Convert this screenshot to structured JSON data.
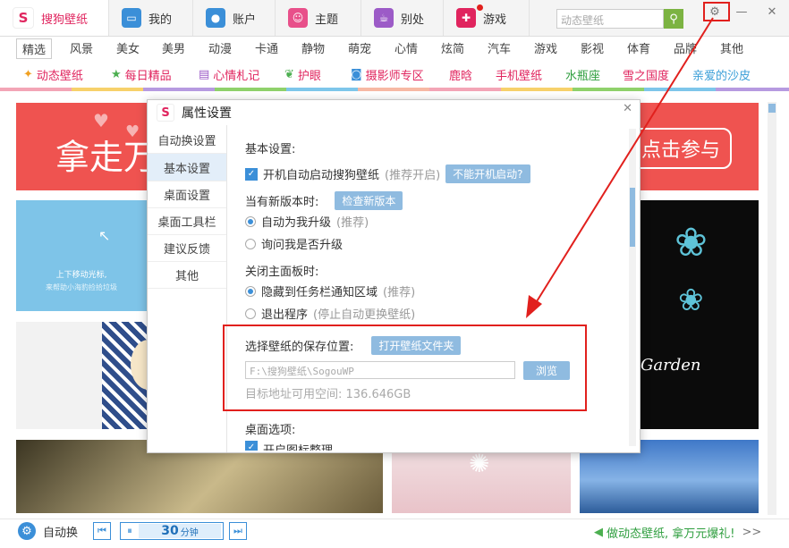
{
  "tabs": [
    {
      "label": "搜狗壁纸",
      "icon": "sogou-logo-icon"
    },
    {
      "label": "我的",
      "icon": "monitor-icon"
    },
    {
      "label": "账户",
      "icon": "user-icon"
    },
    {
      "label": "主题",
      "icon": "theme-icon"
    },
    {
      "label": "别处",
      "icon": "cup-icon"
    },
    {
      "label": "游戏",
      "icon": "gamepad-icon"
    }
  ],
  "search": {
    "placeholder": "动态壁纸"
  },
  "categories": [
    "精选",
    "风景",
    "美女",
    "美男",
    "动漫",
    "卡通",
    "静物",
    "萌宠",
    "心情",
    "炫简",
    "汽车",
    "游戏",
    "影视",
    "体育",
    "品牌",
    "其他"
  ],
  "subcats": [
    "动态壁纸",
    "每日精品",
    "心情札记",
    "护眼",
    "摄影师专区",
    "鹿晗",
    "手机壁纸",
    "水瓶座",
    "雪之国度",
    "亲爱的沙皮"
  ],
  "banner": {
    "left_text": "拿走万",
    "right_text": "点击参与"
  },
  "tile_text": {
    "line1": "上下移动光标,",
    "line2": "来帮助小海豹捡拾垃圾",
    "garden": "Garden"
  },
  "dialog": {
    "title": "属性设置",
    "nav": [
      "自动换设置",
      "基本设置",
      "桌面设置",
      "桌面工具栏",
      "建议反馈",
      "其他"
    ],
    "basic_heading": "基本设置:",
    "autostart": "开机自动启动搜狗壁纸",
    "autostart_hint": "(推荐开启)",
    "autostart_btn": "不能开机启动?",
    "update_heading": "当有新版本时:",
    "update_btn": "检查新版本",
    "update_opt1": "自动为我升级",
    "update_opt1_hint": "(推荐)",
    "update_opt2": "询问我是否升级",
    "close_heading": "关闭主面板时:",
    "close_opt1": "隐藏到任务栏通知区域",
    "close_opt1_hint": "(推荐)",
    "close_opt2": "退出程序",
    "close_opt2_hint": "(停止自动更换壁纸)",
    "save_heading": "选择壁纸的保存位置:",
    "open_folder_btn": "打开壁纸文件夹",
    "path": "F:\\搜狗壁纸\\SogouWP",
    "browse_btn": "浏览",
    "free_space": "目标地址可用空间: 136.646GB",
    "desktop_heading": "桌面选项:",
    "desktop_opt1": "开启图标整理"
  },
  "bottom": {
    "auto_switch": "自动换",
    "interval_value": "30",
    "interval_unit": "分钟",
    "promo": "做动态壁纸, 拿万元爆礼!",
    "more": ">>"
  },
  "colors": {
    "accent": "#e0245e",
    "red_annotation": "#e1201d",
    "button_blue": "#8fbbe0"
  }
}
